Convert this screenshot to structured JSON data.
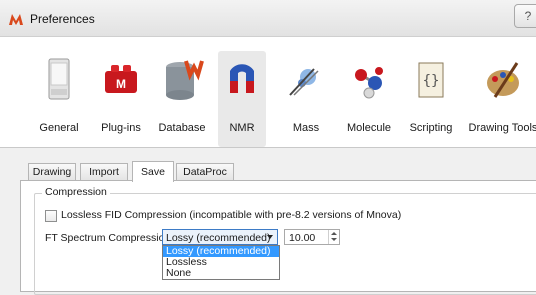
{
  "window": {
    "title": "Preferences",
    "help_label": "?"
  },
  "categories": [
    {
      "label": "General",
      "icon": "general-icon"
    },
    {
      "label": "Plug-ins",
      "icon": "plugins-icon"
    },
    {
      "label": "Database",
      "icon": "database-icon"
    },
    {
      "label": "NMR",
      "icon": "nmr-magnet-icon",
      "selected": true
    },
    {
      "label": "Mass",
      "icon": "mass-icon"
    },
    {
      "label": "Molecule",
      "icon": "molecule-icon"
    },
    {
      "label": "Scripting",
      "icon": "scripting-icon"
    },
    {
      "label": "Drawing Tools",
      "icon": "drawing-tools-icon"
    }
  ],
  "tabs": [
    {
      "label": "Drawing"
    },
    {
      "label": "Import"
    },
    {
      "label": "Save",
      "active": true
    },
    {
      "label": "DataProc"
    }
  ],
  "compression": {
    "group_title": "Compression",
    "lossless_fid_label": "Lossless FID Compression (incompatible with pre-8.2 versions of Mnova)",
    "lossless_fid_checked": false,
    "ft_label": "FT Spectrum Compression:",
    "ft_selected": "Lossy (recommended)",
    "ft_options": [
      "Lossy (recommended)",
      "Lossless",
      "None"
    ],
    "ft_value": "10.00"
  },
  "colors": {
    "accent": "#3399ff",
    "combo_border": "#3d7bc6"
  }
}
